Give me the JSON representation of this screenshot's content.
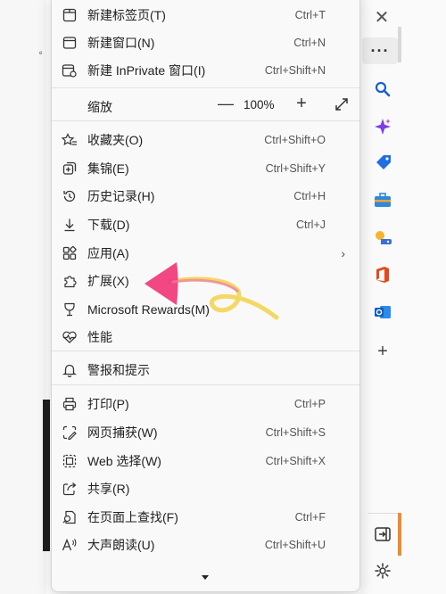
{
  "menu": {
    "items": [
      {
        "id": "new-tab",
        "label": "新建标签页(T)",
        "shortcut": "Ctrl+T",
        "icon": "new-tab-icon"
      },
      {
        "id": "new-window",
        "label": "新建窗口(N)",
        "shortcut": "Ctrl+N",
        "icon": "new-window-icon"
      },
      {
        "id": "new-inprivate",
        "label": "新建 InPrivate 窗口(I)",
        "shortcut": "Ctrl+Shift+N",
        "icon": "inprivate-icon"
      },
      {
        "id": "favorites",
        "label": "收藏夹(O)",
        "shortcut": "Ctrl+Shift+O",
        "icon": "favorites-icon"
      },
      {
        "id": "collections",
        "label": "集锦(E)",
        "shortcut": "Ctrl+Shift+Y",
        "icon": "collections-icon"
      },
      {
        "id": "history",
        "label": "历史记录(H)",
        "shortcut": "Ctrl+H",
        "icon": "history-icon"
      },
      {
        "id": "downloads",
        "label": "下载(D)",
        "shortcut": "Ctrl+J",
        "icon": "download-icon"
      },
      {
        "id": "apps",
        "label": "应用(A)",
        "shortcut": "",
        "icon": "apps-icon"
      },
      {
        "id": "extensions",
        "label": "扩展(X)",
        "shortcut": "",
        "icon": "extensions-icon"
      },
      {
        "id": "rewards",
        "label": "Microsoft Rewards(M)",
        "shortcut": "",
        "icon": "rewards-icon"
      },
      {
        "id": "performance",
        "label": "性能",
        "shortcut": "",
        "icon": "performance-icon"
      },
      {
        "id": "alerts",
        "label": "警报和提示",
        "shortcut": "",
        "icon": "bell-icon"
      },
      {
        "id": "print",
        "label": "打印(P)",
        "shortcut": "Ctrl+P",
        "icon": "print-icon"
      },
      {
        "id": "web-capture",
        "label": "网页捕获(W)",
        "shortcut": "Ctrl+Shift+S",
        "icon": "web-capture-icon"
      },
      {
        "id": "web-select",
        "label": "Web 选择(W)",
        "shortcut": "Ctrl+Shift+X",
        "icon": "web-select-icon"
      },
      {
        "id": "share",
        "label": "共享(R)",
        "shortcut": "",
        "icon": "share-icon"
      },
      {
        "id": "find",
        "label": "在页面上查找(F)",
        "shortcut": "Ctrl+F",
        "icon": "find-icon"
      },
      {
        "id": "read-aloud",
        "label": "大声朗读(U)",
        "shortcut": "Ctrl+Shift+U",
        "icon": "read-aloud-icon"
      }
    ],
    "zoom": {
      "label": "缩放",
      "value": "100%",
      "minus": "—",
      "plus": "+"
    },
    "apps_arrow": "›"
  },
  "sidebar": {
    "close": "✕",
    "more": "···",
    "add": "+",
    "icons": [
      "search-icon",
      "copilot-icon",
      "shopping-tag-icon",
      "tools-icon",
      "games-icon",
      "office-icon",
      "outlook-icon",
      "add-icon",
      "split-screen-icon",
      "settings-icon"
    ]
  },
  "colors": {
    "accent": "#0f6cbd",
    "annotation_pink": "#f0387a",
    "annotation_yellow": "#f3d24a",
    "menu_bg": "#f9f9f9"
  }
}
